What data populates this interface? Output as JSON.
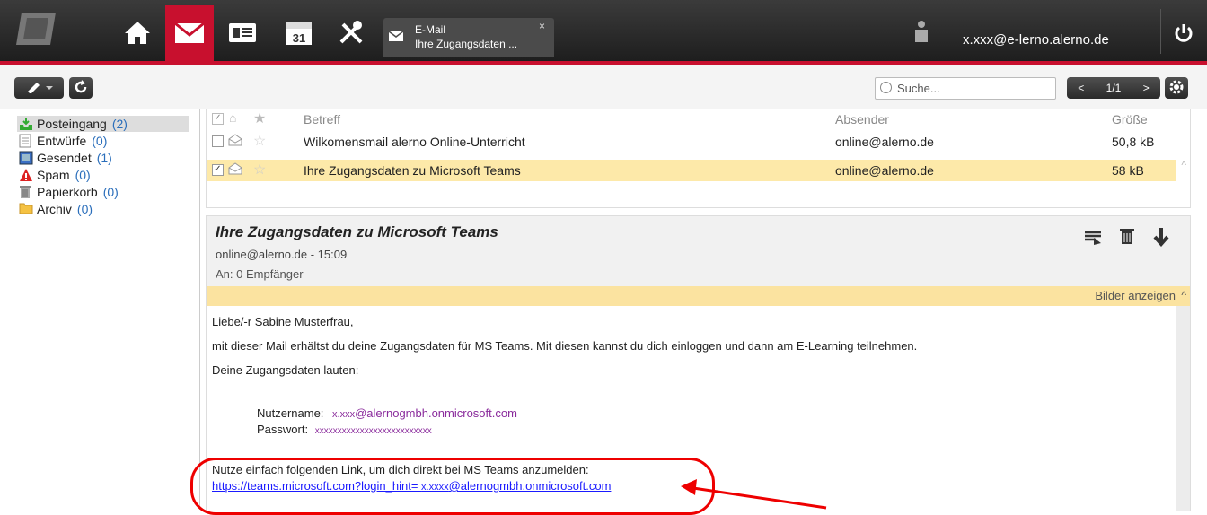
{
  "topbar": {
    "tab_title": "E-Mail",
    "tab_subtitle": "Ihre Zugangsdaten ...",
    "tab_close": "×",
    "user_email": "x.xxx@e-lerno.alerno.de"
  },
  "toolbar": {
    "search_placeholder": "Suche...",
    "pager": "1/1",
    "prev": "<",
    "next": ">"
  },
  "folders": [
    {
      "label": "Posteingang",
      "count": "(2)"
    },
    {
      "label": "Entwürfe",
      "count": "(0)"
    },
    {
      "label": "Gesendet",
      "count": "(1)"
    },
    {
      "label": "Spam",
      "count": "(0)"
    },
    {
      "label": "Papierkorb",
      "count": "(0)"
    },
    {
      "label": "Archiv",
      "count": "(0)"
    }
  ],
  "list": {
    "headers": {
      "subject": "Betreff",
      "sender": "Absender",
      "size": "Größe"
    },
    "rows": [
      {
        "subject": "Wilkomensmail alerno Online-Unterricht",
        "sender": "online@alerno.de",
        "size": "50,8 kB",
        "checked": "",
        "selected": false
      },
      {
        "subject": "Ihre Zugangsdaten zu Microsoft Teams",
        "sender": "online@alerno.de",
        "size": "58 kB",
        "checked": "✓",
        "selected": true
      }
    ]
  },
  "message": {
    "subject": "Ihre Zugangsdaten zu Microsoft Teams",
    "from_line": "online@alerno.de - 15:09",
    "to_line": "An: 0 Empfänger",
    "show_images": "Bilder anzeigen",
    "greeting": "Liebe/-r Sabine Musterfrau,",
    "line1": "mit dieser Mail erhältst du deine Zugangsdaten für MS Teams. Mit diesen kannst du dich einloggen und dann am E-Learning teilnehmen.",
    "line2": "Deine Zugangsdaten lauten:",
    "username_label": "Nutzername:",
    "username_prefix": "x.xxx",
    "username_domain": "@alernogmbh.onmicrosoft.com",
    "password_label": "Passwort:",
    "password_value": "xxxxxxxxxxxxxxxxxxxxxxxxxx",
    "link_intro": "Nutze einfach folgenden Link, um dich direkt bei MS Teams anzumelden:",
    "link_prefix": "https://teams.microsoft.com?login_hint=",
    "link_user": "x.xxxx",
    "link_domain": "@alernogmbh.onmicrosoft.com"
  },
  "colors": {
    "accent": "#c8102e",
    "selected_row": "#fde9a9",
    "link": "#1a1aff",
    "annotation": "#e00000"
  }
}
